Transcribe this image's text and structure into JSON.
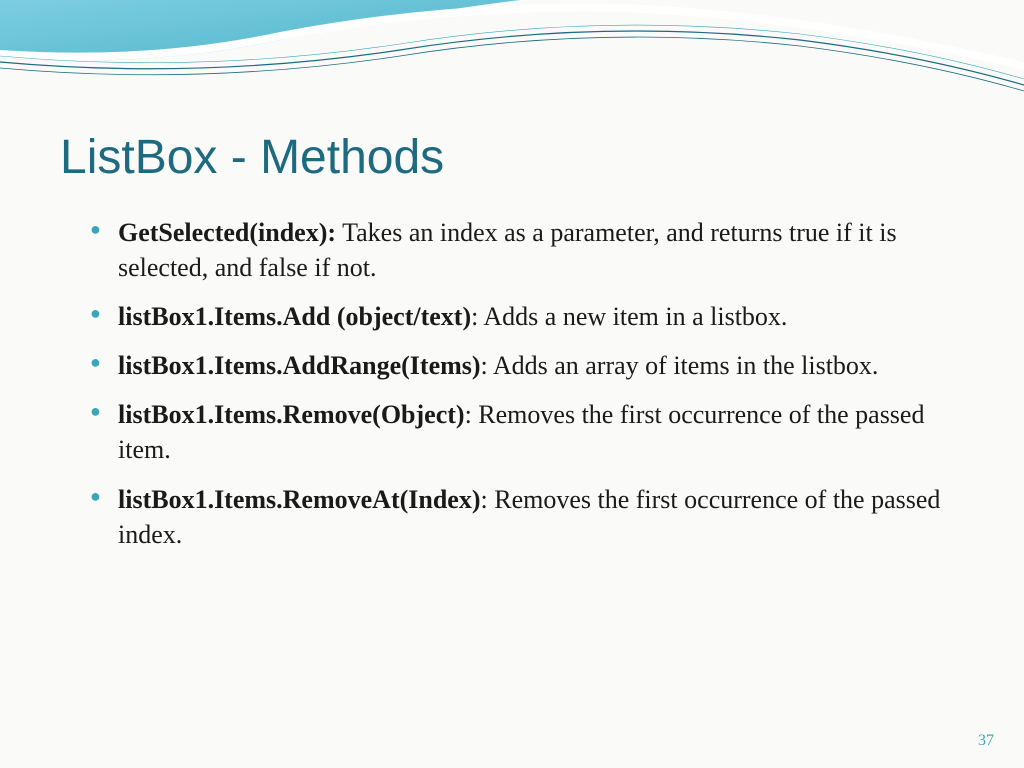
{
  "slide": {
    "title": "ListBox - Methods",
    "page_number": "37",
    "bullets": [
      {
        "method": "GetSelected(index):",
        "description": " Takes an index as a parameter, and returns true if it is selected, and false if not."
      },
      {
        "method": "listBox1.Items.Add (object/text)",
        "description": ": Adds a new item in a listbox."
      },
      {
        "method": "listBox1.Items.AddRange(Items)",
        "description": ": Adds an array of items in the listbox."
      },
      {
        "method": "listBox1.Items.Remove(Object)",
        "description": ": Removes the first occurrence of the passed item."
      },
      {
        "method": "listBox1.Items.RemoveAt(Index)",
        "description": ": Removes the first occurrence of the passed index."
      }
    ]
  }
}
